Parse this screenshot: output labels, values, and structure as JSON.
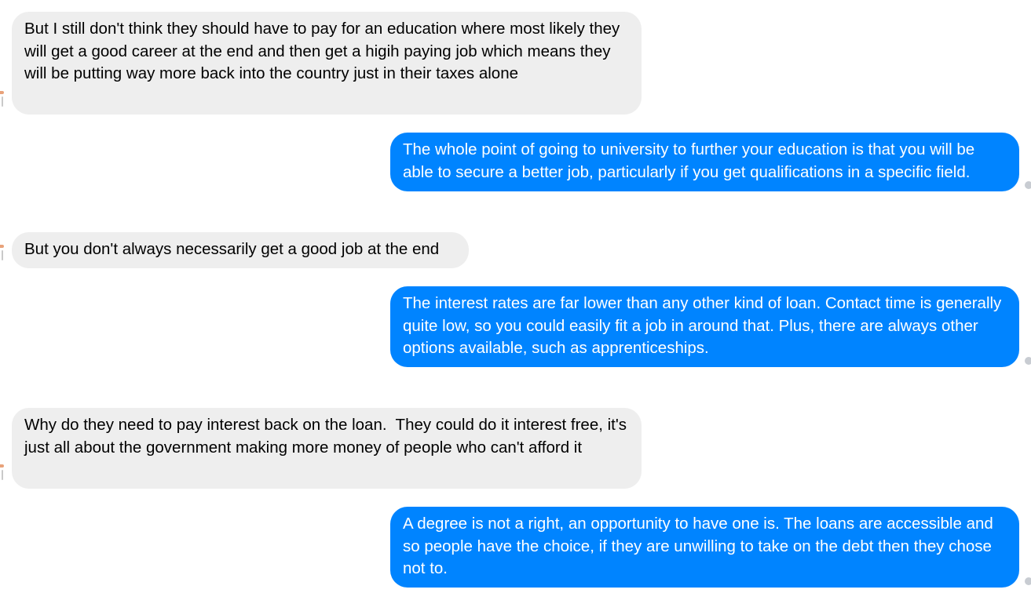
{
  "colors": {
    "incoming_bubble": "#eeeeee",
    "outgoing_bubble": "#0084ff",
    "outgoing_text": "#ffffff",
    "incoming_text": "#000000"
  },
  "messages": [
    {
      "direction": "incoming",
      "text": "But I still don't think they should have to pay for an education where most likely they will get a good career at the end and then get a higih paying job which means they will be putting way more back into the country just in their taxes alone"
    },
    {
      "direction": "outgoing",
      "text": "The whole point of going to university to further your education is that you will be able to secure a better job, particularly if you get qualifications in a specific field."
    },
    {
      "direction": "incoming",
      "text": "But you don't always necessarily get a good job at the end"
    },
    {
      "direction": "outgoing",
      "text": "The interest rates are far lower than any other kind of loan. Contact time is generally quite low, so you could easily fit a job in around that. Plus, there are always other options available, such as apprenticeships."
    },
    {
      "direction": "incoming",
      "text": "Why do they need to pay interest back on the loan.  They could do it interest free, it's just all about the government making more money of people who can't afford it"
    },
    {
      "direction": "outgoing",
      "text": "A degree is not a right, an opportunity to have one is. The loans are accessible and so people have the choice, if they are unwilling to take on the debt then they chose not to."
    }
  ]
}
